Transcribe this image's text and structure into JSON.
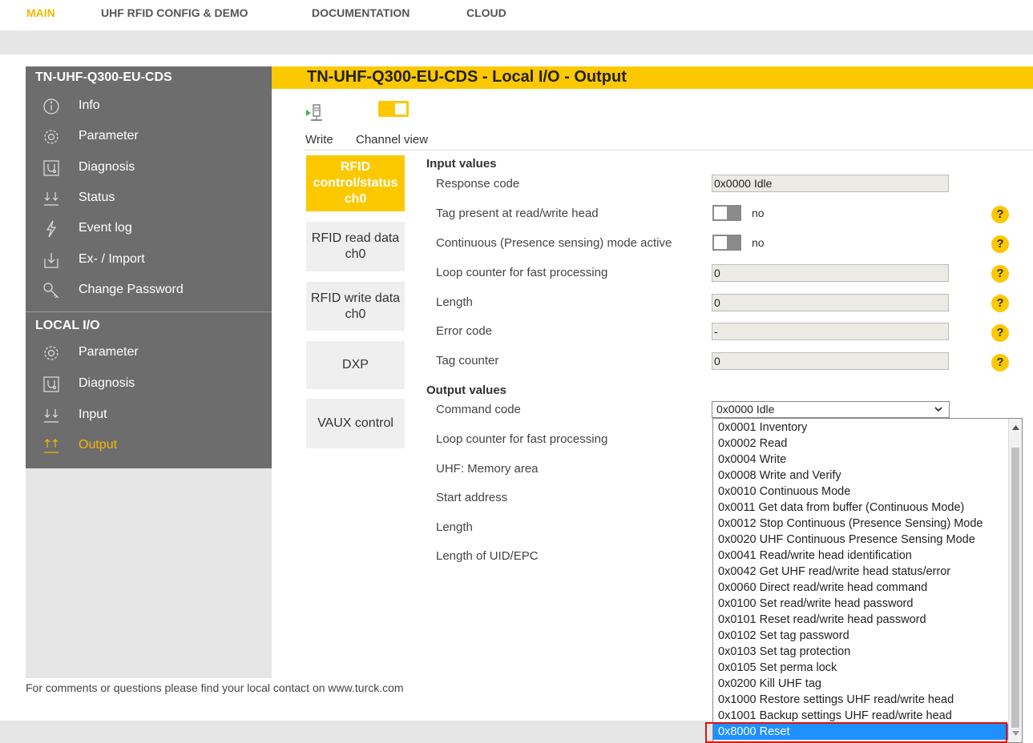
{
  "topnav": {
    "items": [
      {
        "label": "MAIN",
        "active": true
      },
      {
        "label": "UHF RFID CONFIG & DEMO",
        "active": false
      },
      {
        "label": "DOCUMENTATION",
        "active": false
      },
      {
        "label": "CLOUD",
        "active": false
      }
    ]
  },
  "sidebar": {
    "device_title": "TN-UHF-Q300-EU-CDS",
    "device_items": [
      {
        "label": "Info",
        "icon": "info-icon"
      },
      {
        "label": "Parameter",
        "icon": "gear-icon"
      },
      {
        "label": "Diagnosis",
        "icon": "diagnosis-icon"
      },
      {
        "label": "Status",
        "icon": "status-icon"
      },
      {
        "label": "Event log",
        "icon": "lightning-icon"
      },
      {
        "label": "Ex- / Import",
        "icon": "import-icon"
      },
      {
        "label": "Change Password",
        "icon": "key-icon"
      }
    ],
    "local_title": "LOCAL I/O",
    "local_items": [
      {
        "label": "Parameter",
        "icon": "gear-icon"
      },
      {
        "label": "Diagnosis",
        "icon": "diagnosis-icon"
      },
      {
        "label": "Input",
        "icon": "input-icon"
      },
      {
        "label": "Output",
        "icon": "output-icon",
        "active": true
      }
    ]
  },
  "header": {
    "title": "TN-UHF-Q300-EU-CDS - Local I/O - Output"
  },
  "toolbar": {
    "write_label": "Write",
    "channel_view_label": "Channel view"
  },
  "channels": [
    {
      "label": "RFID control/status ch0",
      "active": true
    },
    {
      "label": "RFID read data ch0"
    },
    {
      "label": "RFID write data ch0"
    },
    {
      "label": "DXP"
    },
    {
      "label": "VAUX control"
    }
  ],
  "input_values": {
    "title": "Input values",
    "response_code": {
      "label": "Response code",
      "value": "0x0000 Idle"
    },
    "tag_present": {
      "label": "Tag present at read/write head",
      "value": "no"
    },
    "continuous_mode": {
      "label": "Continuous (Presence sensing) mode active",
      "value": "no"
    },
    "loop_counter": {
      "label": "Loop counter for fast processing",
      "value": "0"
    },
    "length": {
      "label": "Length",
      "value": "0"
    },
    "error_code": {
      "label": "Error code",
      "value": "-"
    },
    "tag_counter": {
      "label": "Tag counter",
      "value": "0"
    }
  },
  "output_values": {
    "title": "Output values",
    "command_code": {
      "label": "Command code",
      "value": "0x0000 Idle"
    },
    "loop_counter": {
      "label": "Loop counter for fast processing"
    },
    "memory_area": {
      "label": "UHF: Memory area"
    },
    "start_address": {
      "label": "Start address"
    },
    "length": {
      "label": "Length"
    },
    "uid_length": {
      "label": "Length of UID/EPC"
    }
  },
  "help_symbol": "?",
  "dropdown": {
    "options": [
      "0x0001 Inventory",
      "0x0002 Read",
      "0x0004 Write",
      "0x0008 Write and Verify",
      "0x0010 Continuous Mode",
      "0x0011 Get data from buffer (Continuous Mode)",
      "0x0012 Stop Continuous (Presence Sensing) Mode",
      "0x0020 UHF Continuous Presence Sensing Mode",
      "0x0041 Read/write head identification",
      "0x0042 Get UHF read/write head status/error",
      "0x0060 Direct read/write head command",
      "0x0100 Set read/write head password",
      "0x0101 Reset read/write head password",
      "0x0102 Set tag password",
      "0x0103 Set tag protection",
      "0x0105 Set perma lock",
      "0x0200 Kill UHF tag",
      "0x1000 Restore settings UHF read/write head",
      "0x1001 Backup settings UHF read/write head",
      "0x8000 Reset"
    ],
    "highlighted": "0x8000 Reset"
  },
  "footer": {
    "text": "For comments or questions please find your local contact on www.turck.com"
  },
  "colors": {
    "accent": "#fcc800",
    "sidebar": "#6d6d6d",
    "selection": "#1e90ff",
    "highlight_border": "#e01010"
  }
}
